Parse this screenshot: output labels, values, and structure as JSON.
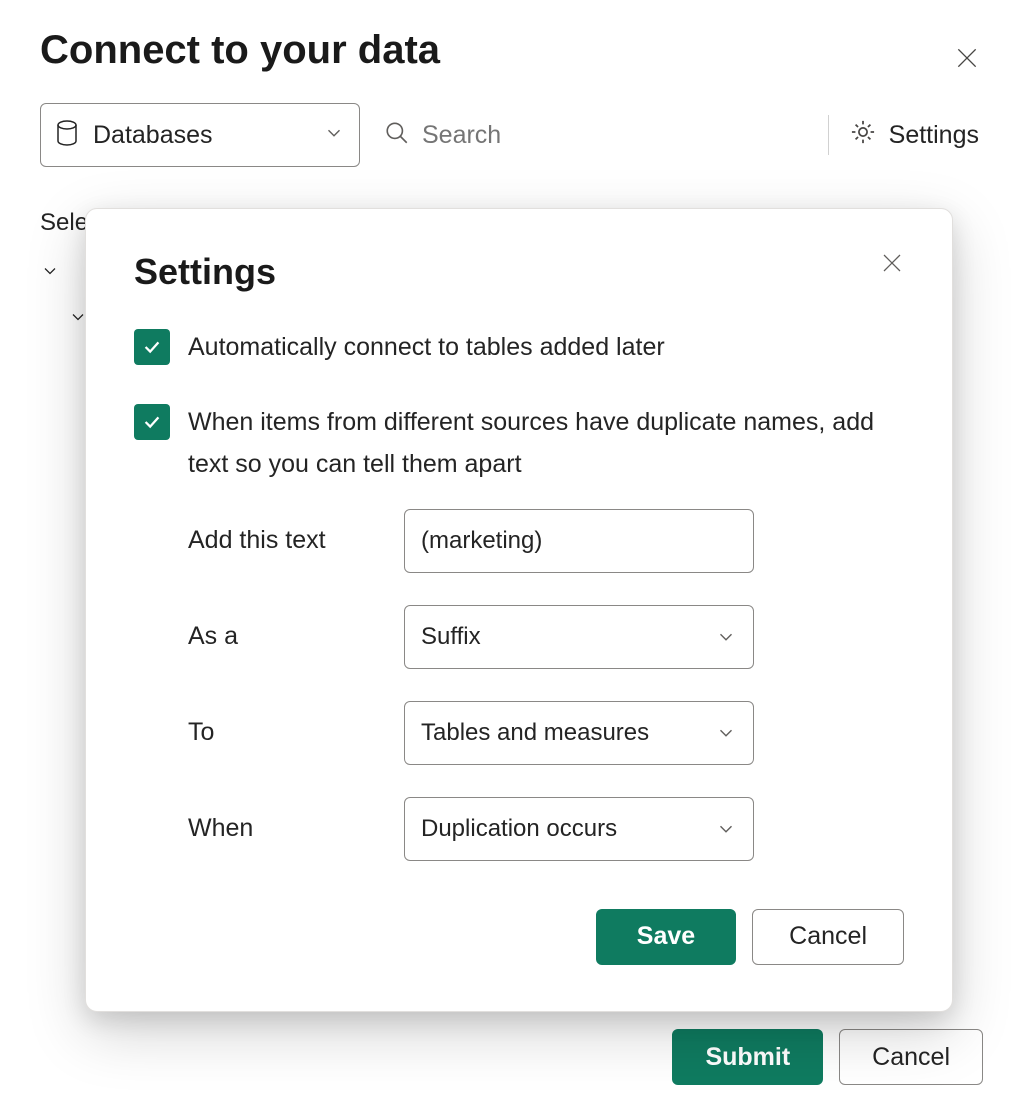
{
  "page": {
    "title": "Connect to your data",
    "select_label": "Sele",
    "submit_label": "Submit",
    "cancel_label": "Cancel"
  },
  "toolbar": {
    "databases_label": "Databases",
    "search_placeholder": "Search",
    "settings_label": "Settings"
  },
  "modal": {
    "title": "Settings",
    "option_auto_connect": "Automatically connect to tables added later",
    "option_dedupe": "When items from different sources have duplicate names, add text so you can tell them apart",
    "form": {
      "add_text_label": "Add this text",
      "add_text_value": "(marketing)",
      "as_a_label": "As a",
      "as_a_value": "Suffix",
      "to_label": "To",
      "to_value": "Tables and measures",
      "when_label": "When",
      "when_value": "Duplication occurs"
    },
    "save_label": "Save",
    "cancel_label": "Cancel"
  }
}
